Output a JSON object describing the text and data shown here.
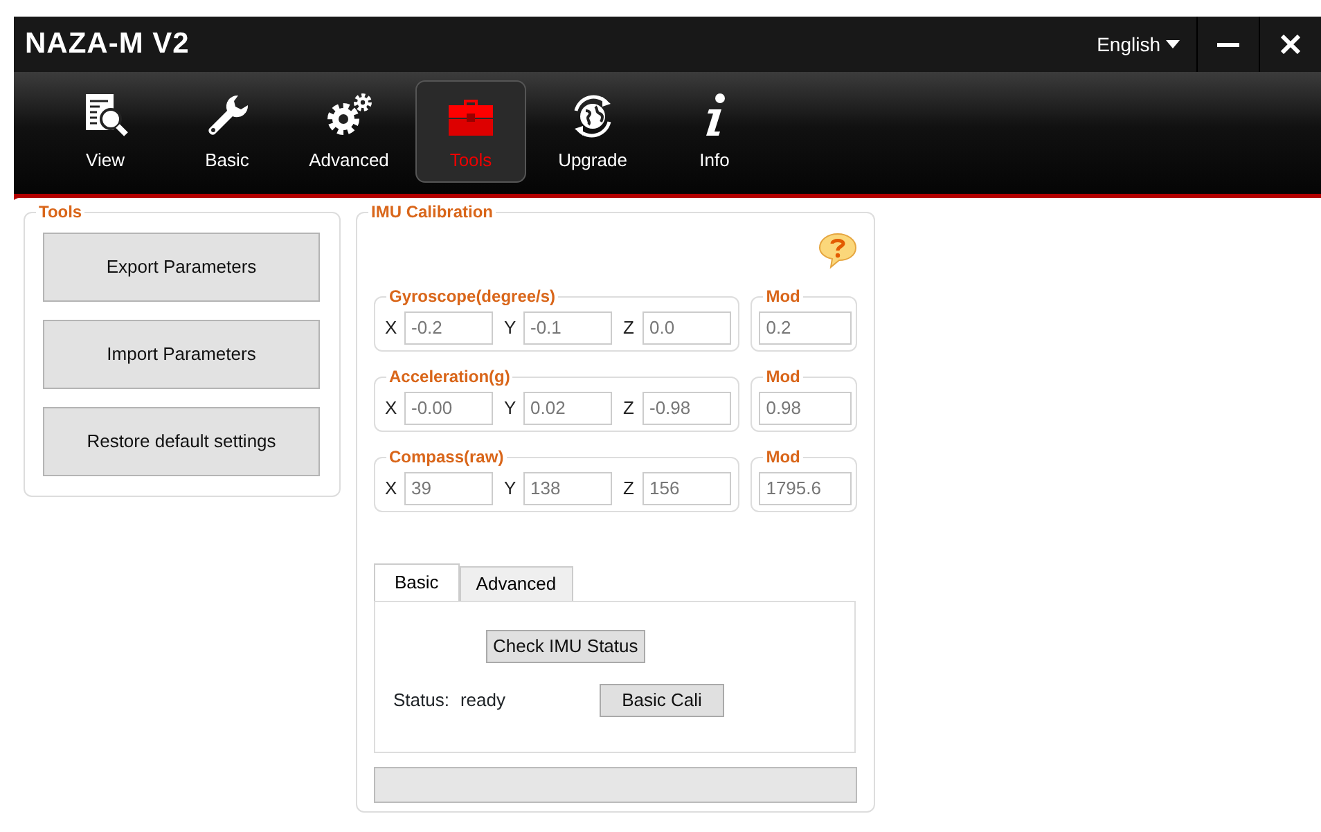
{
  "window": {
    "title": "NAZA-M V2",
    "language": "English"
  },
  "nav": [
    {
      "label": "View",
      "selected": false
    },
    {
      "label": "Basic",
      "selected": false
    },
    {
      "label": "Advanced",
      "selected": false
    },
    {
      "label": "Tools",
      "selected": true
    },
    {
      "label": "Upgrade",
      "selected": false
    },
    {
      "label": "Info",
      "selected": false
    }
  ],
  "tools": {
    "title": "Tools",
    "buttons": [
      "Export Parameters",
      "Import Parameters",
      "Restore default settings"
    ]
  },
  "imu": {
    "title": "IMU Calibration",
    "groups": [
      {
        "title": "Gyroscope(degree/s)",
        "axes": [
          {
            "label": "X",
            "value": "-0.2"
          },
          {
            "label": "Y",
            "value": "-0.1"
          },
          {
            "label": "Z",
            "value": "0.0"
          }
        ],
        "mod_title": "Mod",
        "mod": "0.2"
      },
      {
        "title": "Acceleration(g)",
        "axes": [
          {
            "label": "X",
            "value": "-0.00"
          },
          {
            "label": "Y",
            "value": "0.02"
          },
          {
            "label": "Z",
            "value": "-0.98"
          }
        ],
        "mod_title": "Mod",
        "mod": "0.98"
      },
      {
        "title": "Compass(raw)",
        "axes": [
          {
            "label": "X",
            "value": "39"
          },
          {
            "label": "Y",
            "value": "138"
          },
          {
            "label": "Z",
            "value": "156"
          }
        ],
        "mod_title": "Mod",
        "mod": "1795.6"
      }
    ],
    "tabs": [
      {
        "label": "Basic",
        "selected": true
      },
      {
        "label": "Advanced",
        "selected": false
      }
    ],
    "check_button": "Check IMU Status",
    "status_label": "Status:",
    "status_value": "ready",
    "cali_button": "Basic Cali"
  }
}
